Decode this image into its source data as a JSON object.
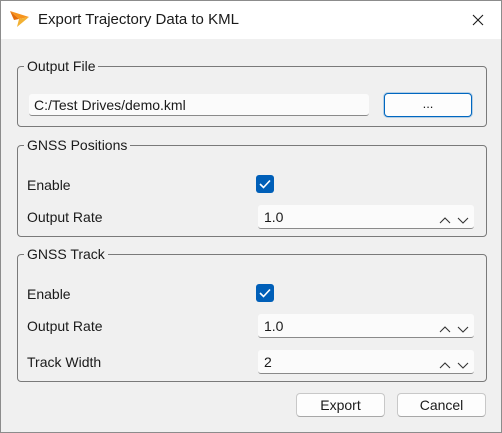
{
  "window": {
    "title": "Export Trajectory Data to KML",
    "app_icon": "xsens-logo-icon",
    "close_icon": "close-icon"
  },
  "output_file": {
    "legend": "Output File",
    "path_value": "C:/Test Drives/demo.kml",
    "browse_label": "..."
  },
  "gnss_positions": {
    "legend": "GNSS Positions",
    "enable_label": "Enable",
    "enable_checked": true,
    "rate_label": "Output Rate",
    "rate_value": "1.0"
  },
  "gnss_track": {
    "legend": "GNSS Track",
    "enable_label": "Enable",
    "enable_checked": true,
    "rate_label": "Output Rate",
    "rate_value": "1.0",
    "width_label": "Track Width",
    "width_value": "2"
  },
  "buttons": {
    "export_label": "Export",
    "cancel_label": "Cancel"
  },
  "colors": {
    "accent": "#005fb8",
    "logo_orange": "#f7941d"
  }
}
